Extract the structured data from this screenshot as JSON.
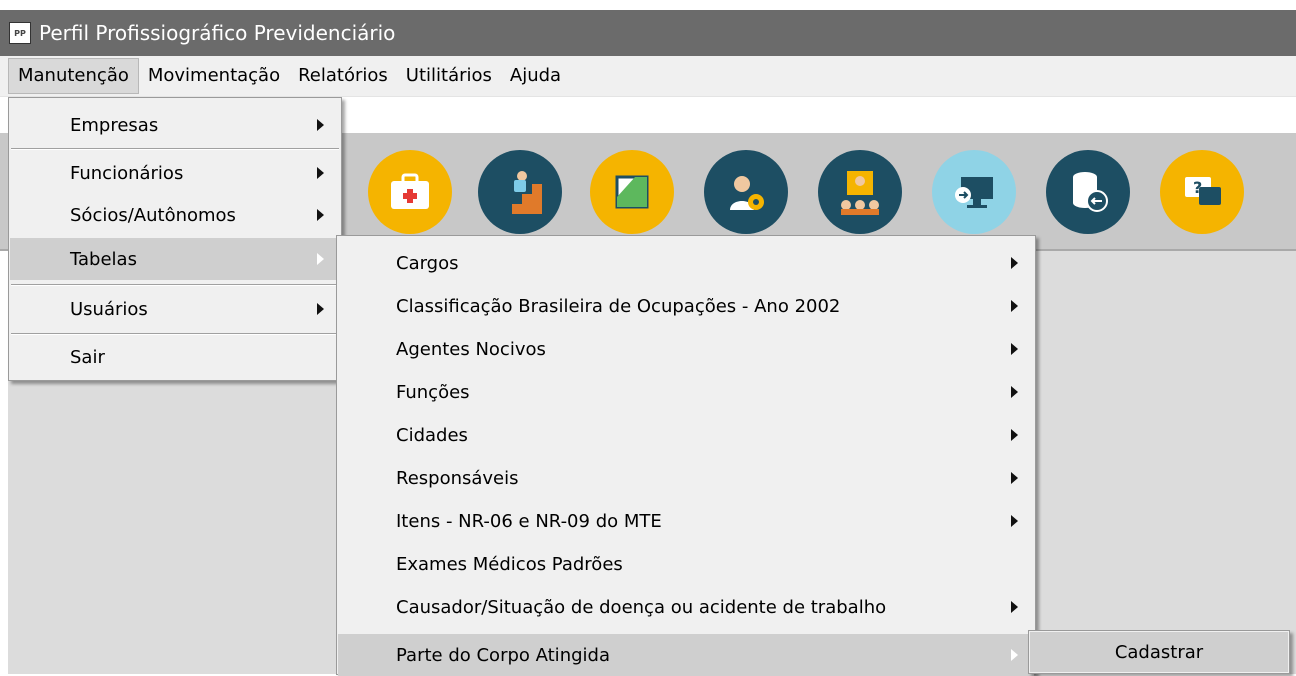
{
  "window": {
    "title": "Perfil Profissiográfico Previdenciário",
    "icon_text": "PP"
  },
  "menubar": [
    "Manutenção",
    "Movimentação",
    "Relatórios",
    "Utilitários",
    "Ajuda"
  ],
  "toolbar_icons": [
    "medical-kit-icon",
    "stairs-fall-icon",
    "document-icon",
    "support-gear-icon",
    "meeting-icon",
    "screen-icon",
    "database-icon",
    "help-chat-icon"
  ],
  "menu_manutencao": {
    "empresas": "Empresas",
    "funcionarios": "Funcionários",
    "socios": "Sócios/Autônomos",
    "tabelas": "Tabelas",
    "usuarios": "Usuários",
    "sair": "Sair"
  },
  "menu_tabelas": {
    "cargos": "Cargos",
    "cbo": "Classificação Brasileira de Ocupações - Ano 2002",
    "agentes": "Agentes Nocivos",
    "funcoes": "Funções",
    "cidades": "Cidades",
    "responsaveis": "Responsáveis",
    "itens": "Itens - NR-06 e NR-09 do MTE",
    "exames": "Exames Médicos Padrões",
    "causador": "Causador/Situação de doença ou acidente de trabalho",
    "parte": "Parte do Corpo Atingida"
  },
  "menu_parte": {
    "cadastrar": "Cadastrar"
  }
}
